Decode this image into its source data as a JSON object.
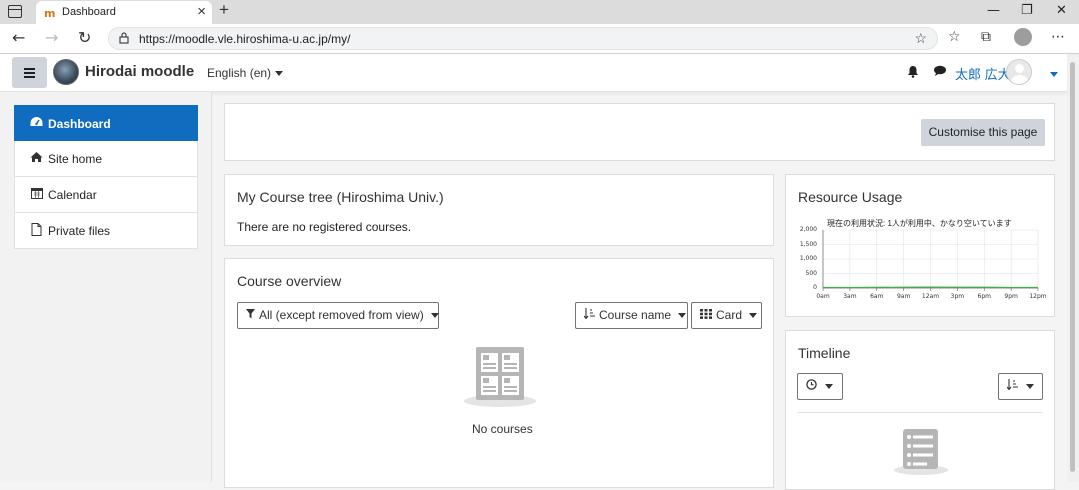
{
  "browser": {
    "tab_title": "Dashboard",
    "tab_favicon": "m",
    "url": "https://moodle.vle.hiroshima-u.ac.jp/my/"
  },
  "navbar": {
    "site_name": "Hirodai moodle",
    "language": "English (en)",
    "user_name": "太郎 広大"
  },
  "sidebar": {
    "items": [
      {
        "label": "Dashboard",
        "icon": "dashboard-icon",
        "active": true
      },
      {
        "label": "Site home",
        "icon": "home-icon",
        "active": false
      },
      {
        "label": "Calendar",
        "icon": "calendar-icon",
        "active": false
      },
      {
        "label": "Private files",
        "icon": "file-icon",
        "active": false
      }
    ]
  },
  "main": {
    "customise_label": "Customise this page",
    "course_tree": {
      "title": "My Course tree (Hiroshima Univ.)",
      "message": "There are no registered courses."
    },
    "course_overview": {
      "title": "Course overview",
      "filter_label": "All (except removed from view)",
      "sort_label": "Course name",
      "view_label": "Card",
      "empty_text": "No courses"
    },
    "resource_usage": {
      "title": "Resource Usage"
    },
    "timeline": {
      "title": "Timeline"
    }
  },
  "chart_data": {
    "type": "area",
    "title": "現在の利用状況: 1人が利用中、かなり空いています",
    "x_ticks": [
      "0am",
      "3am",
      "6am",
      "9am",
      "12am",
      "3pm",
      "6pm",
      "9pm",
      "12pm"
    ],
    "y_ticks": [
      "2,000",
      "1,500",
      "1,000",
      "500",
      "0"
    ],
    "ylim": [
      0,
      2000
    ],
    "x": [
      0,
      3,
      6,
      9,
      12,
      15,
      18,
      21,
      24
    ],
    "series": [
      {
        "values": [
          0,
          0,
          5,
          10,
          15,
          10,
          8,
          2,
          0
        ]
      }
    ],
    "grid": true,
    "series_color": "#3cb043"
  }
}
